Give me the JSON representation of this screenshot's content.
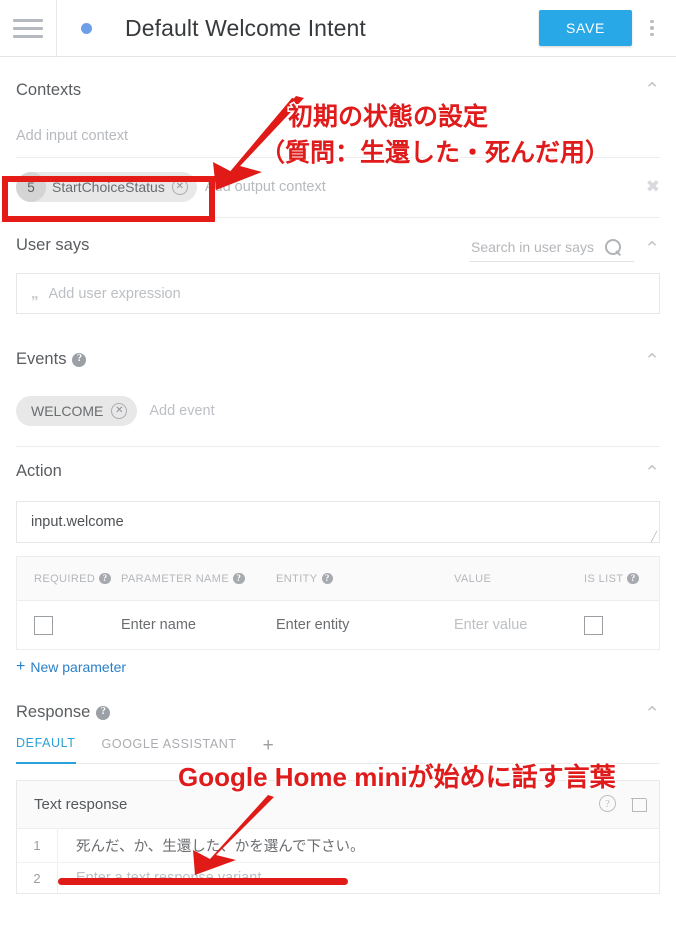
{
  "header": {
    "title": "Default Welcome Intent",
    "save_label": "SAVE",
    "menu_icon": "hamburger-icon",
    "status_dot_color": "#6f9ee8",
    "save_color": "#29a8e8"
  },
  "contexts": {
    "title": "Contexts",
    "add_input_placeholder": "Add input context",
    "add_output_placeholder": "Add output context",
    "chip": {
      "count": "5",
      "label": "StartChoiceStatus"
    }
  },
  "user_says": {
    "title": "User says",
    "search_placeholder": "Search in user says",
    "search_value": "",
    "expression_placeholder": "Add user expression"
  },
  "events": {
    "title": "Events",
    "chip_label": "WELCOME",
    "add_placeholder": "Add event"
  },
  "action": {
    "title": "Action",
    "value": "input.welcome",
    "table": {
      "headers": [
        "REQUIRED",
        "PARAMETER NAME",
        "ENTITY",
        "VALUE",
        "IS LIST"
      ],
      "rows": [
        {
          "required": false,
          "name": "Enter name",
          "entity": "Enter entity",
          "value": "Enter value",
          "is_list": false
        }
      ]
    },
    "new_parameter_label": "New parameter"
  },
  "response": {
    "title": "Response",
    "tabs": [
      {
        "label": "DEFAULT",
        "active": true
      },
      {
        "label": "GOOGLE ASSISTANT",
        "active": false
      }
    ],
    "add_tab_label": "+",
    "card_title": "Text response",
    "lines": [
      {
        "n": "1",
        "text": "死んだ、か、生還した、かを選んで下さい。",
        "placeholder": false
      },
      {
        "n": "2",
        "text": "Enter a text response variant",
        "placeholder": true
      }
    ]
  },
  "annotations": {
    "color": "#e01b1b",
    "top_line1": "初期の状態の設定",
    "top_line2": "（質問：生還した・死んだ用）",
    "bottom_line": "Google Home miniが始めに話す言葉"
  }
}
